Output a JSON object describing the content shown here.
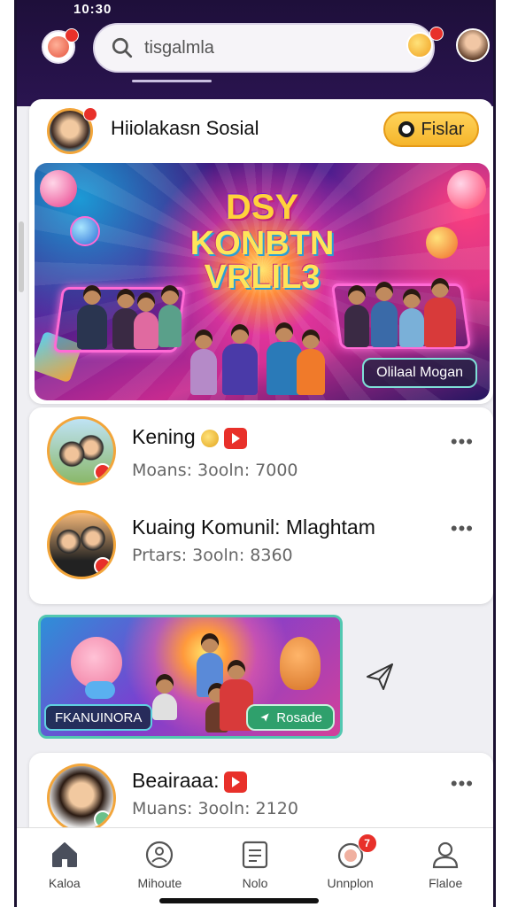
{
  "status_bar": {
    "time": "10:30"
  },
  "search": {
    "value": "tisgalmla"
  },
  "header": {
    "logo_badge": "",
    "coin_badge": ""
  },
  "community": {
    "title": "Hiiolakasn Sosial",
    "follow_label": "Fislar",
    "banner": {
      "title_line1": "DSY",
      "title_line2": "KONBTN",
      "title_line3": "VRLIL3",
      "chip_label": "Olilaal Mogan"
    }
  },
  "groups": [
    {
      "name": "Kening",
      "meta": "Moans: 3ooln: 7000"
    },
    {
      "name": "Kuaing Komunil: Mlaghtam",
      "meta": "Prtars: 3ooln: 8360"
    }
  ],
  "promo": {
    "left_label": "FKANUINORA",
    "right_label": "Rosade"
  },
  "third_group": {
    "name": "Beairaaa:",
    "meta": "Muans: 3ooln: 2120"
  },
  "bottom_nav": [
    {
      "label": "Kaloa",
      "icon": "home-icon"
    },
    {
      "label": "Mihoute",
      "icon": "community-icon"
    },
    {
      "label": "Nolo",
      "icon": "notes-icon"
    },
    {
      "label": "Unnplon",
      "icon": "notification-icon",
      "badge": "7"
    },
    {
      "label": "Flaloe",
      "icon": "profile-icon"
    }
  ],
  "colors": {
    "header_bg": "#1e0f3a",
    "accent_yellow": "#f5b52b",
    "badge_red": "#e8302a",
    "avatar_ring": "#f2a53a",
    "promo_chip_green": "#2fa06c"
  }
}
